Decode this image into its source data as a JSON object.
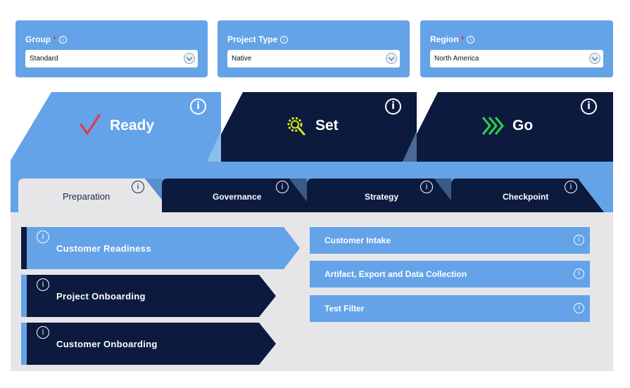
{
  "filters": {
    "group": {
      "label": "Group",
      "required": "*",
      "value": "Standard"
    },
    "project_type": {
      "label": "Project Type",
      "value": "Native"
    },
    "region": {
      "label": "Region",
      "required": "*",
      "value": "North America"
    }
  },
  "info_glyph": "i",
  "stages": {
    "ready": {
      "label": "Ready",
      "icon": "checkmark-icon",
      "color": "#e8344a"
    },
    "set": {
      "label": "Set",
      "icon": "gear-icon",
      "color": "#d4e81a"
    },
    "go": {
      "label": "Go",
      "icon": "double-chevron-icon",
      "color": "#2fd14a"
    }
  },
  "subtabs": [
    "Preparation",
    "Governance",
    "Strategy",
    "Checkpoint"
  ],
  "steps": [
    "Customer Readiness",
    "Project Onboarding",
    "Customer Onboarding"
  ],
  "tasks": [
    "Customer Intake",
    "Artifact, Export and Data Collection",
    "Test Filter"
  ],
  "colors": {
    "light_blue": "#64a3e8",
    "navy": "#0b1a3d",
    "panel_gray": "#e6e6e9"
  }
}
